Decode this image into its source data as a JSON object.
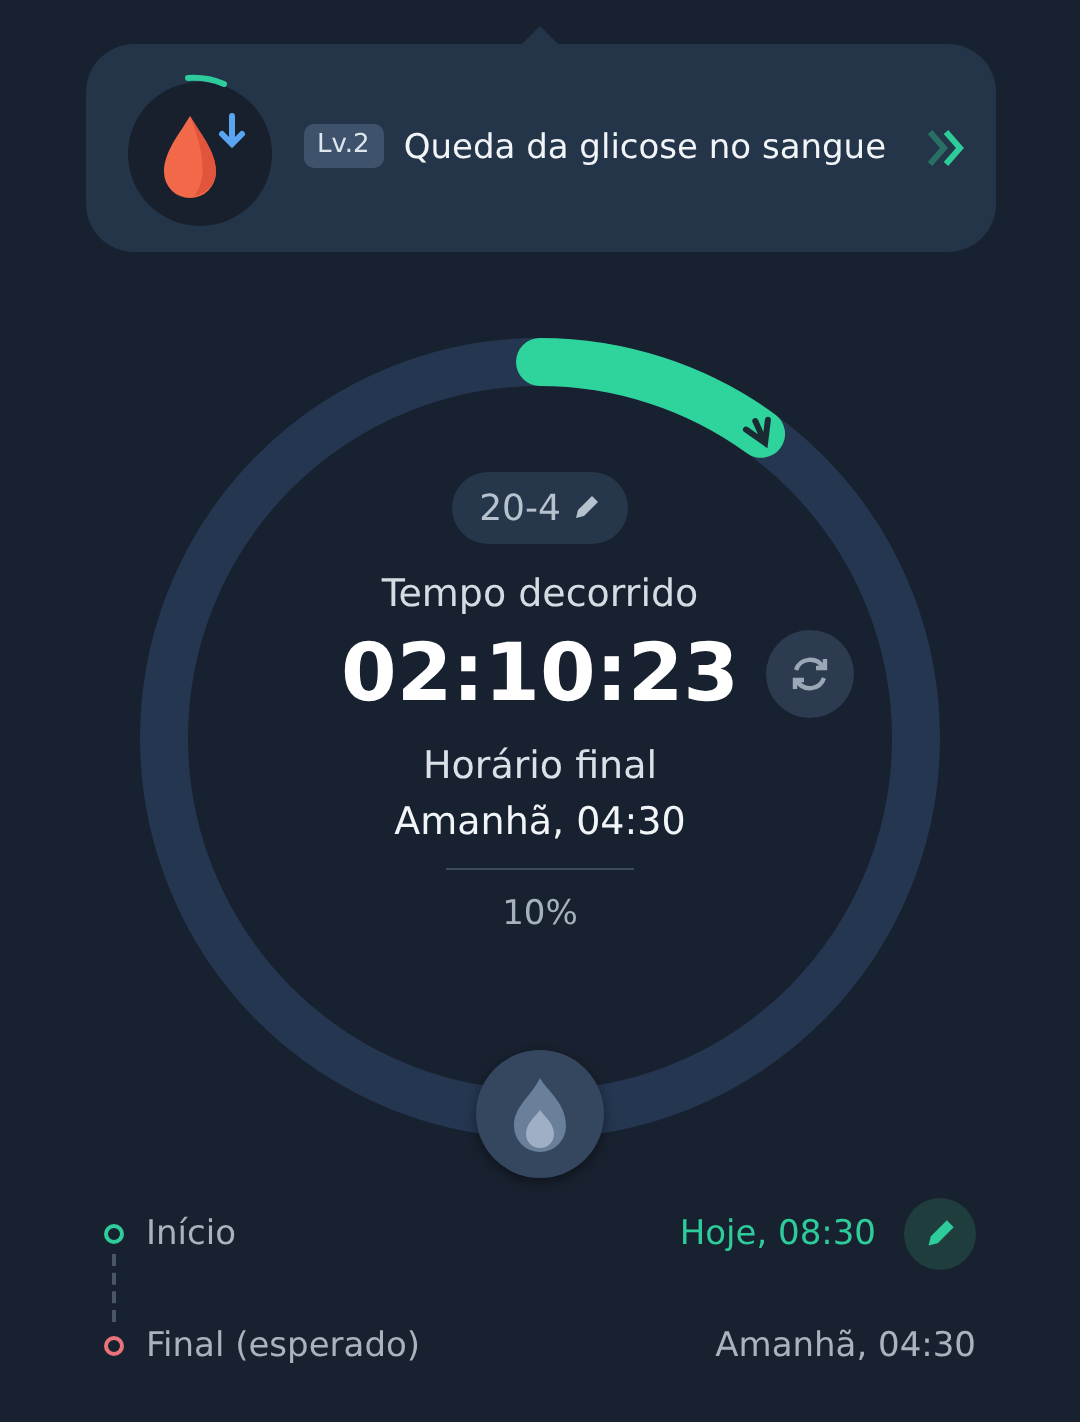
{
  "tip": {
    "level": "Lv.2",
    "text": "Queda da glicose no sangue"
  },
  "ring": {
    "plan": "20-4",
    "elapsed_label": "Tempo decorrido",
    "elapsed": "02:10:23",
    "end_label": "Horário final",
    "end_value": "Amanhã, 04:30",
    "percent": "10%"
  },
  "timeline": [
    {
      "label": "Início",
      "value": "Hoje, 08:30",
      "color": "#2ecc9a",
      "editable": true
    },
    {
      "label": "Final (esperado)",
      "value": "Amanhã, 04:30",
      "color": "#e8737a",
      "editable": false
    }
  ]
}
